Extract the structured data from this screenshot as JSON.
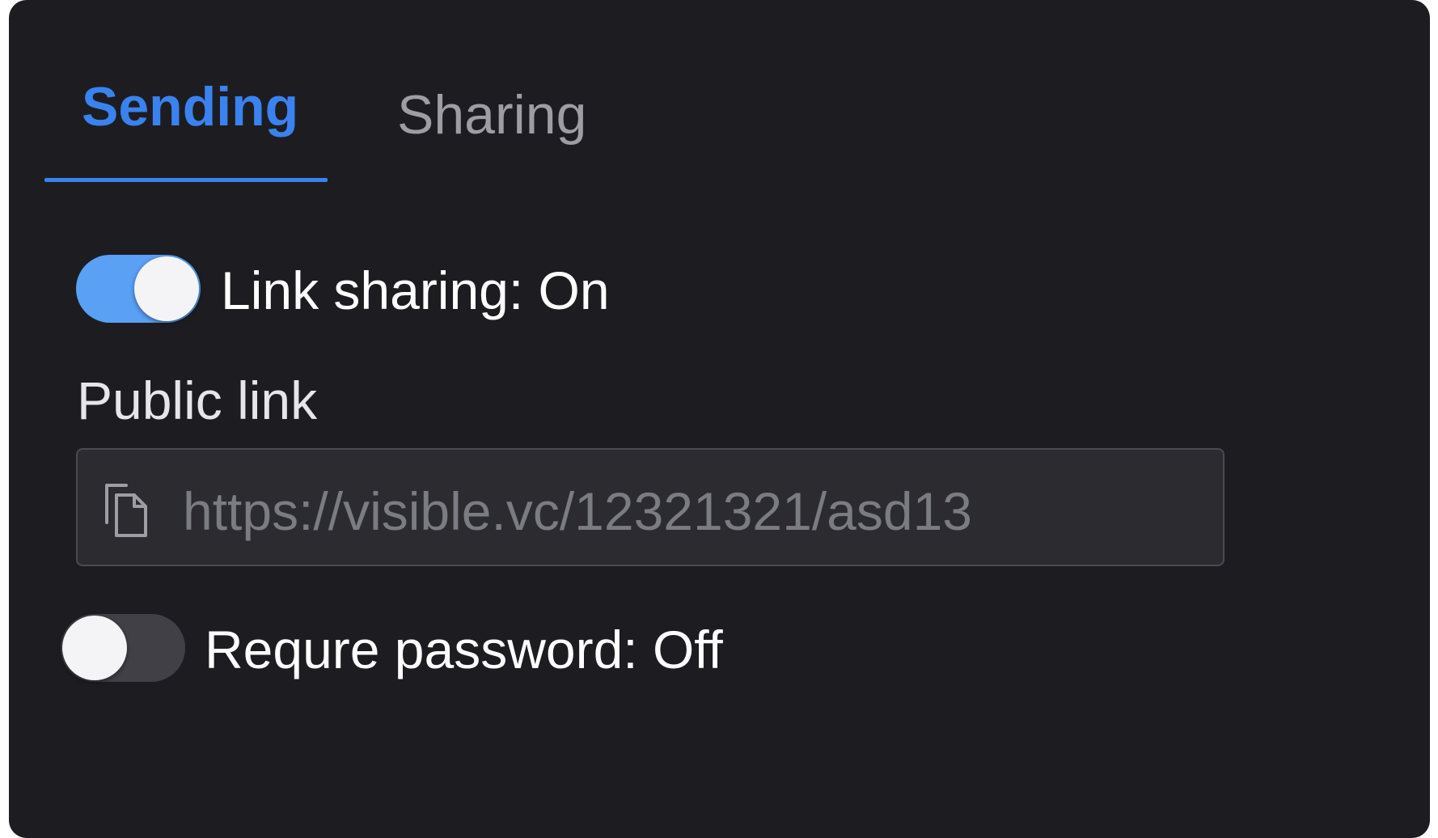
{
  "tabs": [
    {
      "label": "Sending",
      "active": true
    },
    {
      "label": "Sharing",
      "active": false
    }
  ],
  "link_sharing": {
    "label": "Link sharing: On",
    "enabled": true
  },
  "public_link": {
    "label": "Public link",
    "value": "https://visible.vc/12321321/asd13",
    "icon": "copy-icon"
  },
  "require_password": {
    "label": "Requre password: Off",
    "enabled": false
  },
  "colors": {
    "accent": "#3a82f0",
    "toggle_on": "#5aa0f5",
    "panel_background": "#1d1d21"
  }
}
